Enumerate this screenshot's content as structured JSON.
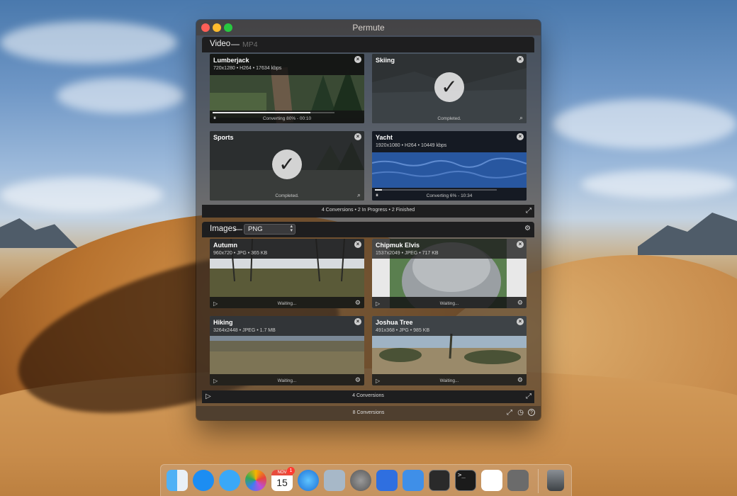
{
  "window": {
    "title": "Permute"
  },
  "video": {
    "label": "Video",
    "dash": "—",
    "format": "MP4",
    "footer": "4 Conversions • 2 In Progress • 2 Finished",
    "items": [
      {
        "title": "Lumberjack",
        "meta": "720x1280 • H264 • 17634 kbps",
        "status": "Converting 80% - 00:10",
        "progress": 0.8
      },
      {
        "title": "Skiing",
        "meta": "",
        "status": "Completed."
      },
      {
        "title": "Sports",
        "meta": "",
        "status": "Completed."
      },
      {
        "title": "Yacht",
        "meta": "1920x1080 • H264 • 10449 kbps",
        "status": "Converting 6% - 10:34",
        "progress": 0.06
      }
    ]
  },
  "images": {
    "label": "Images",
    "dash": "—",
    "format": "PNG",
    "footer": "4 Conversions",
    "items": [
      {
        "title": "Autumn",
        "meta": "960x720 • JPG • 365 KB",
        "status": "Waiting..."
      },
      {
        "title": "Chipmuk Elvis",
        "meta": "1537x2049 • JPEG • 717 KB",
        "status": "Waiting..."
      },
      {
        "title": "Hiking",
        "meta": "3264x2448 • JPEG • 1.7 MB",
        "status": "Waiting..."
      },
      {
        "title": "Joshua Tree",
        "meta": "491x368 • JPG • 985 KB",
        "status": "Waiting..."
      }
    ]
  },
  "bottom": {
    "text": "8 Conversions"
  },
  "icons": {
    "close": "×",
    "check": "✓",
    "pause": "⏸",
    "play": "▷",
    "search": "⌕",
    "gear": "⚙",
    "fit": "⤢",
    "history": "◷",
    "help": "?",
    "updown": "▴▾"
  },
  "dock": {
    "calendar_month": "NOV",
    "calendar_day": "15",
    "badge": "1",
    "terminal": ">_"
  }
}
